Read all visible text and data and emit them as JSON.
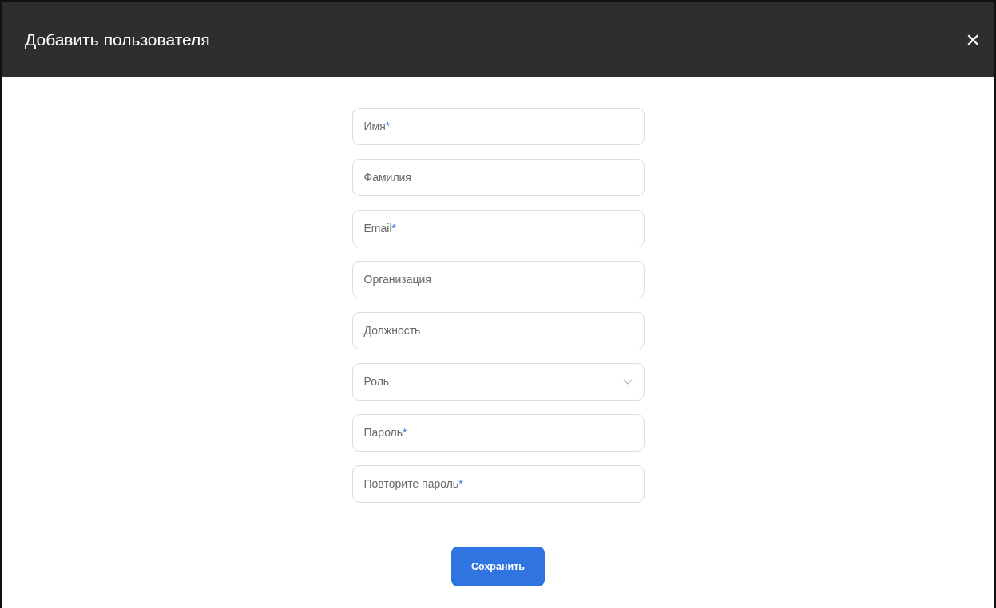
{
  "dialog": {
    "title": "Добавить пользователя",
    "close": "×"
  },
  "fields": [
    {
      "kind": "text",
      "placeholder": "Имя",
      "required_mark": "*"
    },
    {
      "kind": "text",
      "placeholder": "Фамилия"
    },
    {
      "kind": "text",
      "placeholder": "Email",
      "required_mark": "*"
    },
    {
      "kind": "text",
      "placeholder": "Организация"
    },
    {
      "kind": "text",
      "placeholder": "Должность"
    },
    {
      "kind": "select",
      "placeholder": "Роль"
    },
    {
      "kind": "text",
      "placeholder": "Пароль",
      "required_mark": "*"
    },
    {
      "kind": "text",
      "placeholder": "Повторите пароль",
      "required_mark": "*"
    }
  ],
  "submit_button": "Сохранить"
}
